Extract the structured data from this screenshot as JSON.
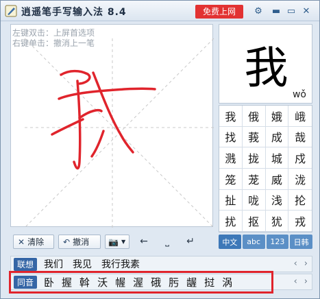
{
  "window": {
    "title": "逍遥笔手写输入法 8.4",
    "online_button": "免费上网"
  },
  "titlebar_icons": [
    "gear-icon",
    "minimize-icon",
    "maximize-icon",
    "close-icon"
  ],
  "pad": {
    "hint_line1": "左键双击：上屏首选项",
    "hint_line2": "右键单击：撤消上一笔"
  },
  "toolbar": {
    "clear_label": "清除",
    "undo_label": "撤消"
  },
  "preview": {
    "character": "我",
    "pinyin": "wǒ"
  },
  "candidates": [
    "我",
    "俄",
    "娥",
    "峨",
    "找",
    "莪",
    "成",
    "哉",
    "溅",
    "拢",
    "城",
    "戍",
    "笼",
    "茏",
    "威",
    "泷",
    "扯",
    "咙",
    "浅",
    "抡",
    "扰",
    "抠",
    "犹",
    "戎"
  ],
  "modes": [
    "中文",
    "abc",
    "123",
    "日韩"
  ],
  "association": {
    "tag": "联想",
    "words": [
      "我们",
      "我见",
      "我行我素"
    ]
  },
  "homophones": {
    "tag": "同音",
    "chars": [
      "卧",
      "握",
      "斡",
      "沃",
      "幄",
      "渥",
      "硪",
      "肟",
      "龌",
      "挝",
      "涡"
    ]
  },
  "colors": {
    "accent": "#3566a6",
    "online": "#e23232",
    "ink": "#e0242c",
    "highlight": "#e0242c"
  }
}
